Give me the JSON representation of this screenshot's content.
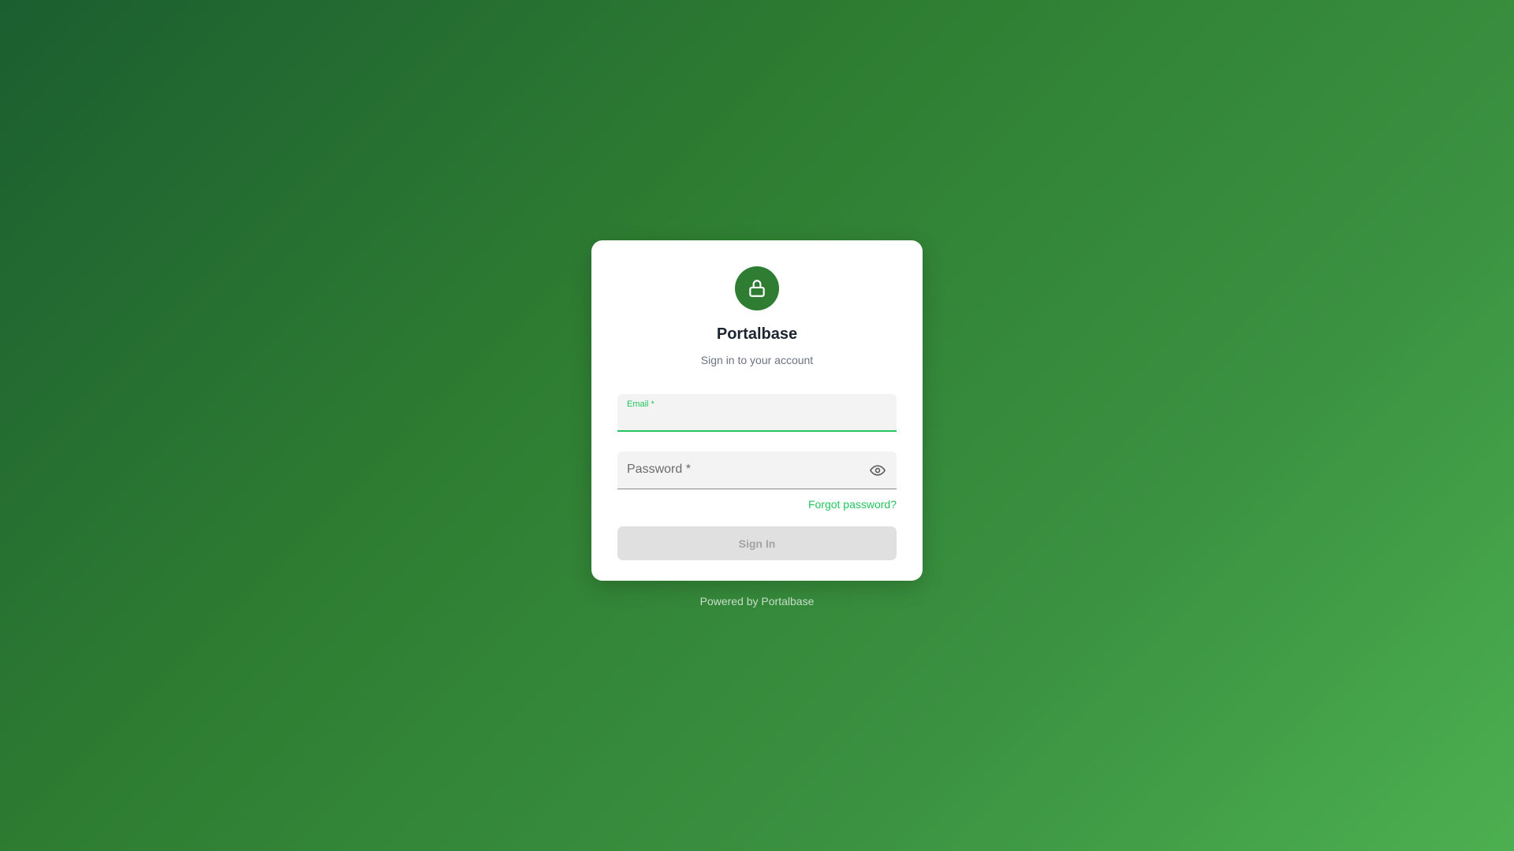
{
  "brand": {
    "title": "Portalbase",
    "subtitle": "Sign in to your account",
    "icon": "lock-icon",
    "accent_color": "#2e7d32",
    "focus_color": "#22c55e"
  },
  "form": {
    "email": {
      "label": "Email *",
      "value": ""
    },
    "password": {
      "label": "Password *",
      "value": "",
      "toggle_icon": "eye-icon"
    },
    "forgot_link": "Forgot password?",
    "submit_label": "Sign In",
    "submit_disabled": true
  },
  "footer": {
    "text": "Powered by Portalbase"
  }
}
